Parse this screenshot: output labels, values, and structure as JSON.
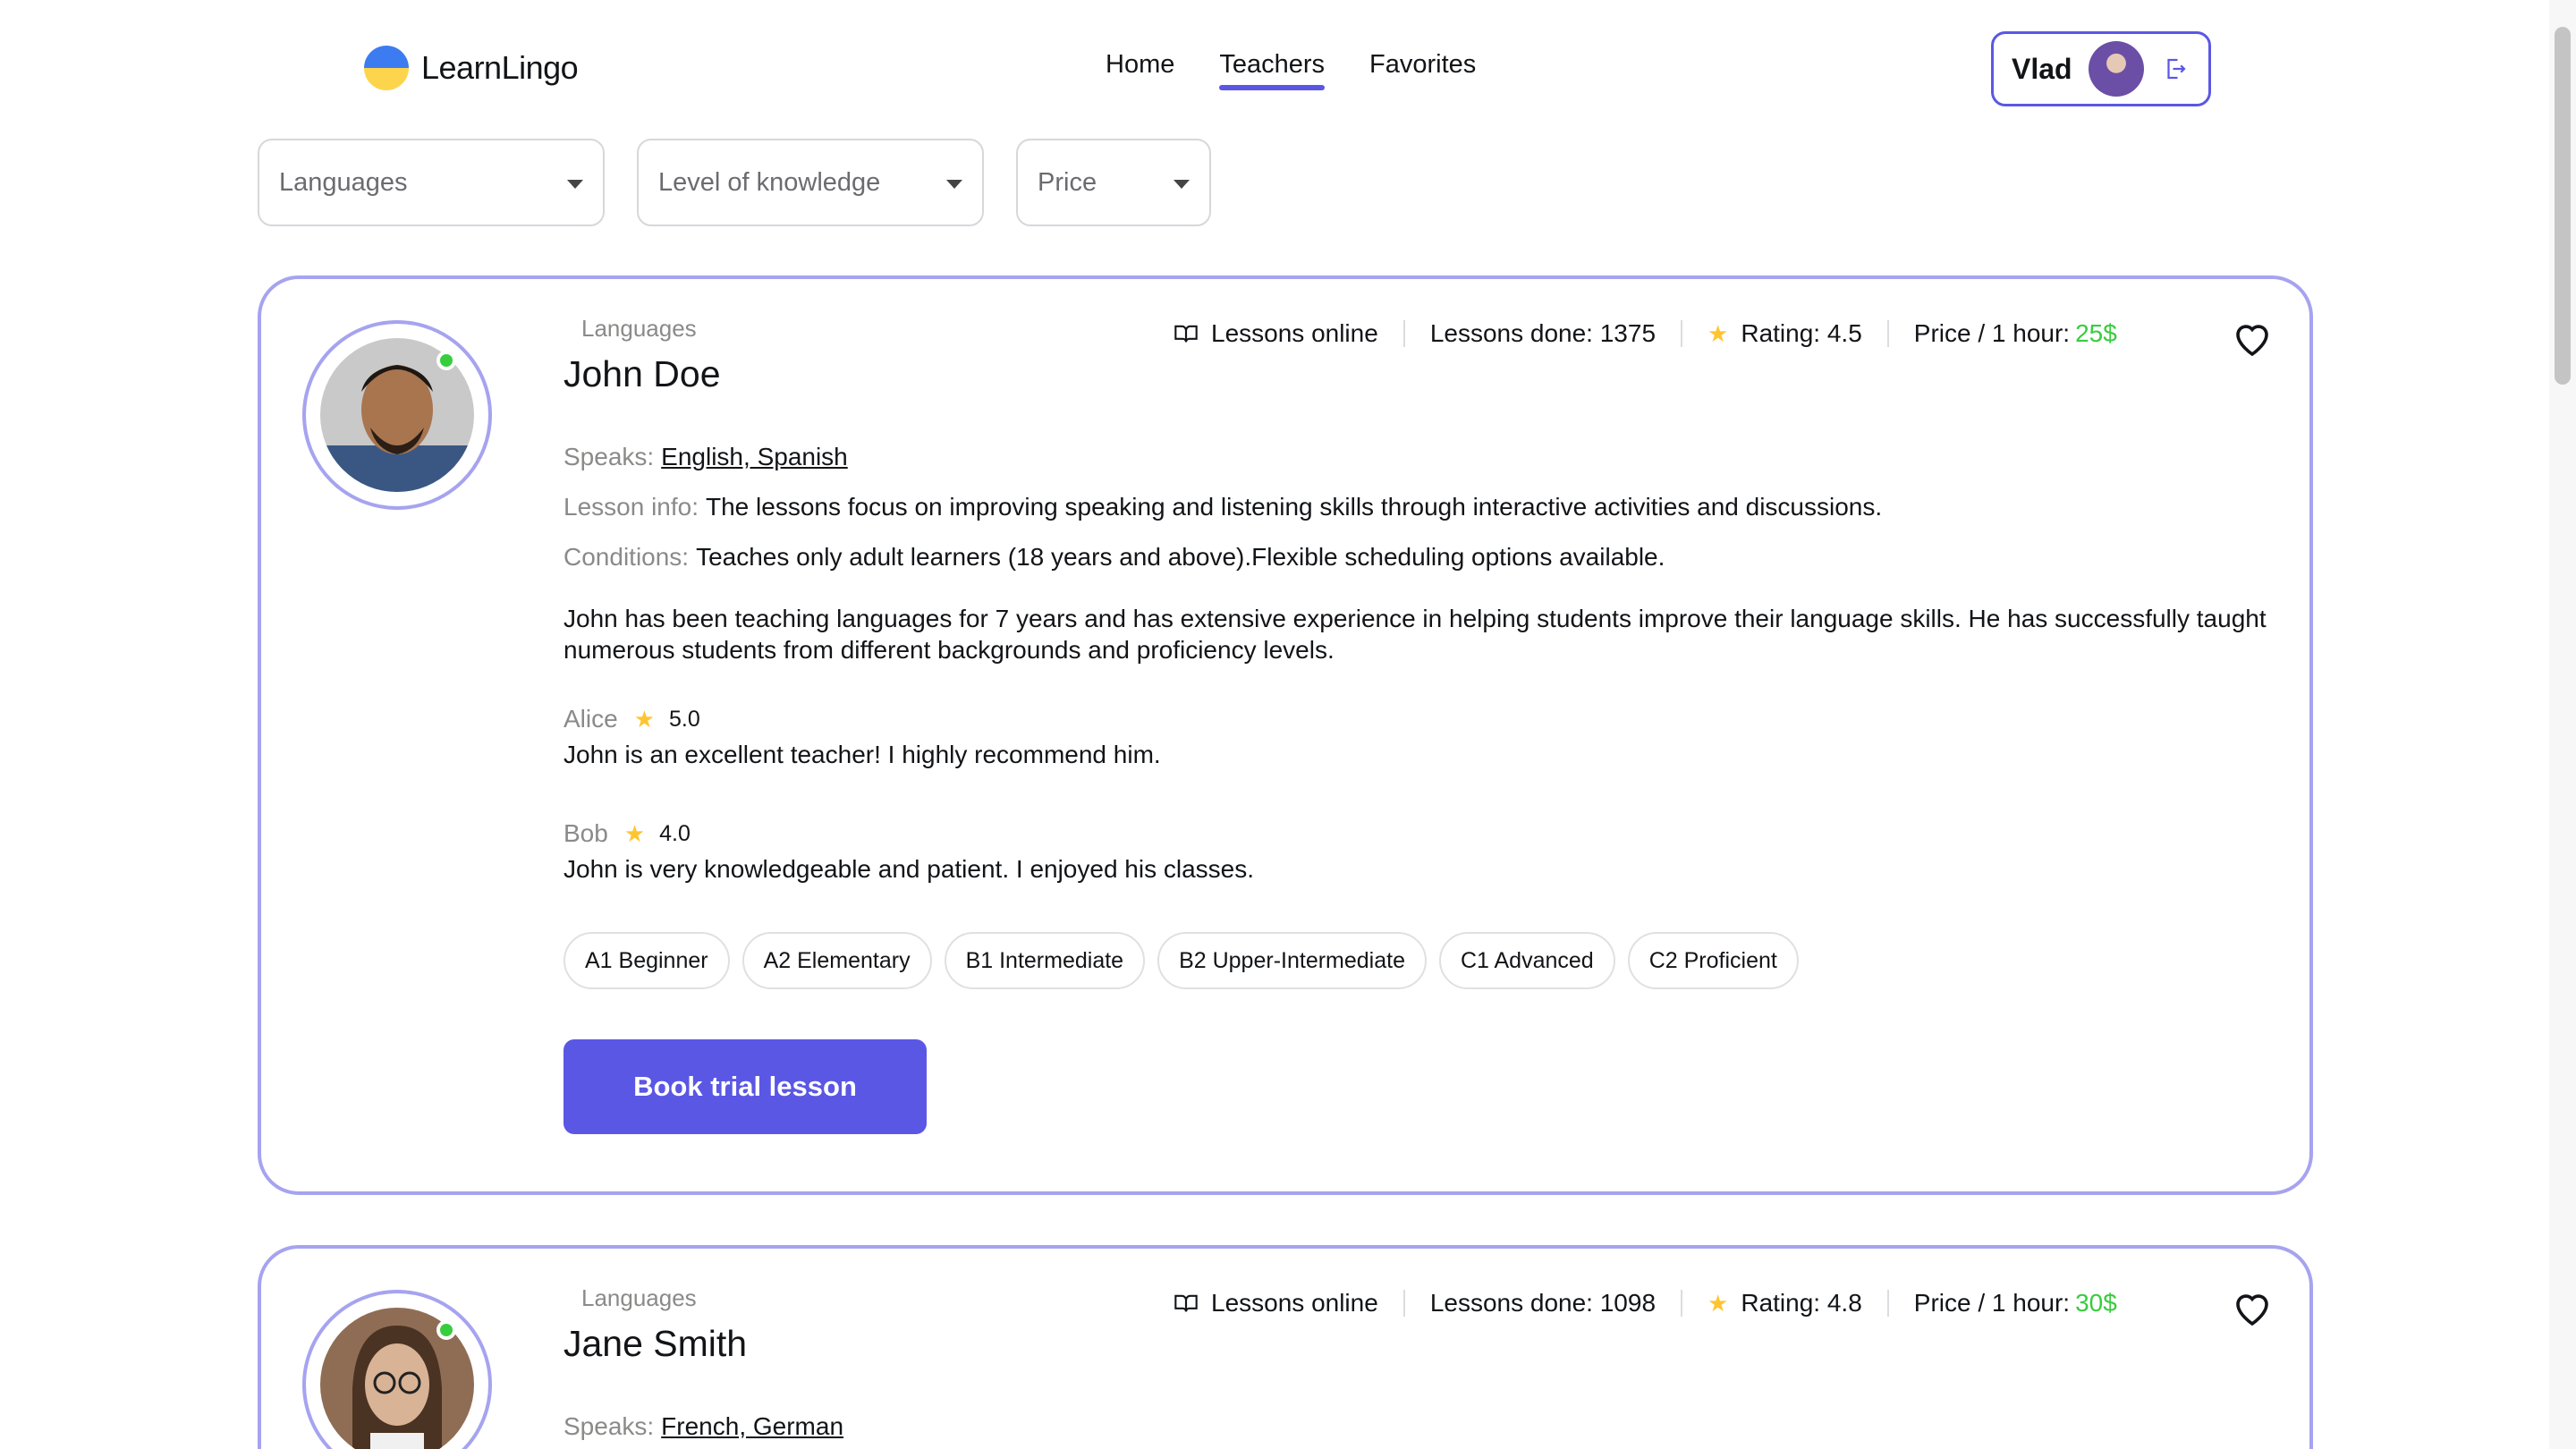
{
  "header": {
    "logo": "LearnLingo",
    "nav": [
      {
        "label": "Home",
        "active": false
      },
      {
        "label": "Teachers",
        "active": true
      },
      {
        "label": "Favorites",
        "active": false
      }
    ],
    "user": {
      "name": "Vlad"
    }
  },
  "filters": [
    {
      "placeholder": "Languages"
    },
    {
      "placeholder": "Level of knowledge"
    },
    {
      "placeholder": "Price"
    }
  ],
  "teachers": [
    {
      "section_label": "Languages",
      "name": "John Doe",
      "stats": {
        "online": "Lessons online",
        "lessons_done": "Lessons done: 1375",
        "rating": "Rating: 4.5",
        "price_label": "Price / 1 hour:",
        "price_value": "25$"
      },
      "speaks_label": "Speaks:",
      "speaks": "English, Spanish",
      "lesson_info_label": "Lesson info:",
      "lesson_info": "The lessons focus on improving speaking and listening skills through interactive activities and discussions.",
      "conditions_label": "Conditions:",
      "conditions": "Teaches only adult learners (18 years and above).Flexible scheduling options available.",
      "about": "John has been teaching languages for 7 years and has extensive experience in helping students improve their language skills. He has successfully taught numerous students from different backgrounds and proficiency levels.",
      "reviews": [
        {
          "name": "Alice",
          "rating": "5.0",
          "comment": "John is an excellent teacher! I highly recommend him."
        },
        {
          "name": "Bob",
          "rating": "4.0",
          "comment": "John is very knowledgeable and patient. I enjoyed his classes."
        }
      ],
      "levels": [
        "A1 Beginner",
        "A2 Elementary",
        "B1 Intermediate",
        "B2 Upper-Intermediate",
        "C1 Advanced",
        "C2 Proficient"
      ],
      "button": "Book trial lesson"
    },
    {
      "section_label": "Languages",
      "name": "Jane Smith",
      "stats": {
        "online": "Lessons online",
        "lessons_done": "Lessons done: 1098",
        "rating": "Rating: 4.8",
        "price_label": "Price / 1 hour:",
        "price_value": "30$"
      },
      "speaks_label": "Speaks:",
      "speaks": "French, German"
    }
  ],
  "colors": {
    "accent": "#5a57e5",
    "card_border": "#a6a3f0",
    "price": "#38cd3e",
    "star": "#ffc531",
    "muted": "#8a8a89"
  }
}
